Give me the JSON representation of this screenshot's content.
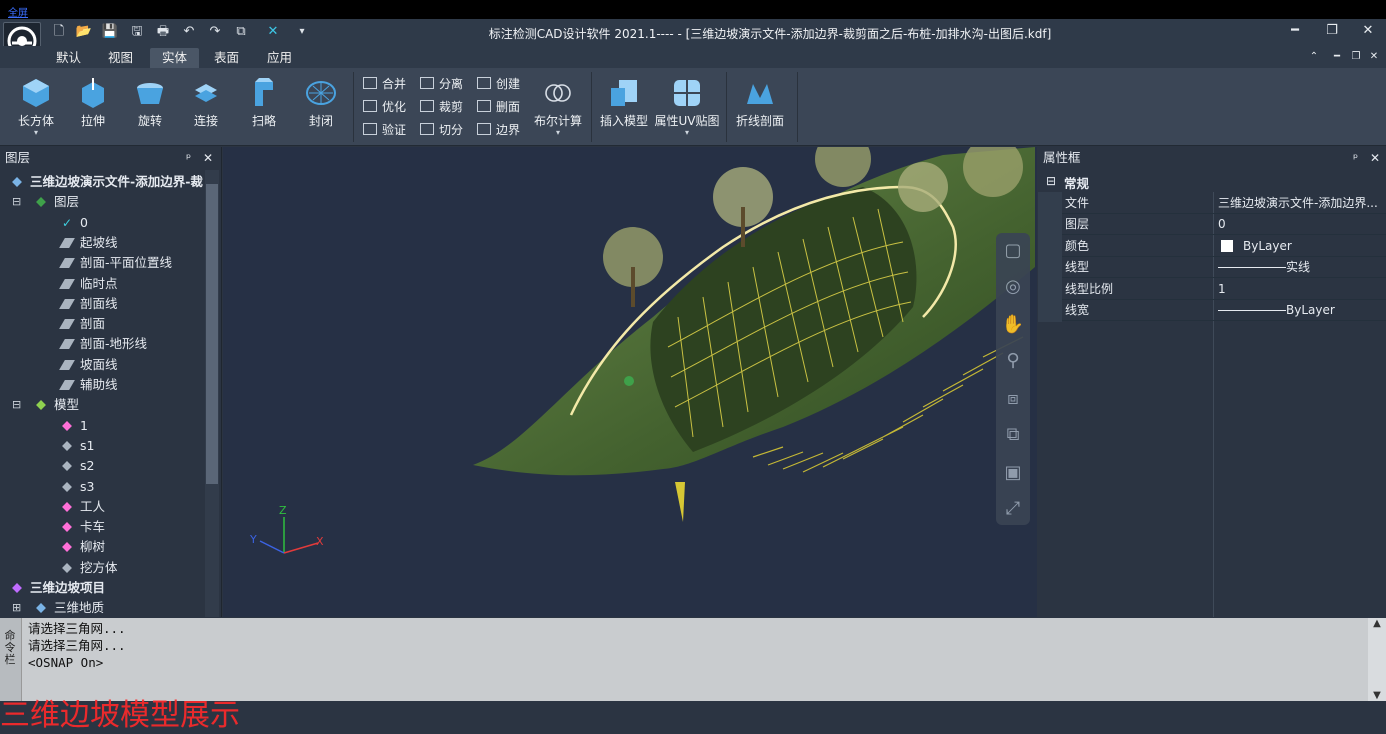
{
  "top_strip": {
    "label": "全屏"
  },
  "app": {
    "title": "标注检测CAD设计软件 2021.1---- - [三维边坡演示文件-添加边界-裁剪面之后-布桩-加排水沟-出图后.kdf]"
  },
  "menu_tabs": [
    {
      "label": "默认",
      "active": false
    },
    {
      "label": "视图",
      "active": false
    },
    {
      "label": "实体",
      "active": true
    },
    {
      "label": "表面",
      "active": false
    },
    {
      "label": "应用",
      "active": false
    }
  ],
  "ribbon": {
    "large": [
      {
        "label": "长方体",
        "icon": "box-icon",
        "dropdown": true
      },
      {
        "label": "拉伸",
        "icon": "extrude-icon",
        "dropdown": false
      },
      {
        "label": "旋转",
        "icon": "revolve-icon",
        "dropdown": false
      },
      {
        "label": "连接",
        "icon": "connect-icon",
        "dropdown": false
      },
      {
        "label": "扫略",
        "icon": "sweep-icon",
        "dropdown": false
      },
      {
        "label": "封闭",
        "icon": "close-mesh-icon",
        "dropdown": false
      }
    ],
    "small": [
      {
        "label": "合并",
        "icon": "merge-icon"
      },
      {
        "label": "优化",
        "icon": "optimize-icon"
      },
      {
        "label": "验证",
        "icon": "verify-icon"
      },
      {
        "label": "分离",
        "icon": "separate-icon"
      },
      {
        "label": "裁剪",
        "icon": "trim-icon"
      },
      {
        "label": "切分",
        "icon": "split-icon"
      },
      {
        "label": "创建",
        "icon": "create-icon"
      },
      {
        "label": "删面",
        "icon": "delete-face-icon"
      },
      {
        "label": "边界",
        "icon": "boundary-icon"
      }
    ],
    "boolean": {
      "label": "布尔计算",
      "icon": "boolean-icon"
    },
    "extra": [
      {
        "label": "插入模型",
        "icon": "insert-model-icon"
      },
      {
        "label": "属性UV贴图",
        "icon": "uv-map-icon"
      },
      {
        "label": "折线剖面",
        "icon": "polyline-section-icon"
      }
    ]
  },
  "layers_panel": {
    "title": "图层",
    "pin": "ᵖ",
    "close": "✕",
    "items": [
      {
        "label": "三维边坡演示文件-添加边界-裁",
        "level": 0,
        "expander": "",
        "kind": "file"
      },
      {
        "label": "图层",
        "level": 1,
        "expander": "⊟",
        "kind": "layers"
      },
      {
        "label": "0",
        "level": 2,
        "expander": "",
        "kind": "check"
      },
      {
        "label": "起坡线",
        "level": 2,
        "expander": "",
        "kind": "layer"
      },
      {
        "label": "剖面-平面位置线",
        "level": 2,
        "expander": "",
        "kind": "layer"
      },
      {
        "label": "临时点",
        "level": 2,
        "expander": "",
        "kind": "layer"
      },
      {
        "label": "剖面线",
        "level": 2,
        "expander": "",
        "kind": "layer"
      },
      {
        "label": "剖面",
        "level": 2,
        "expander": "",
        "kind": "layer"
      },
      {
        "label": "剖面-地形线",
        "level": 2,
        "expander": "",
        "kind": "layer"
      },
      {
        "label": "坡面线",
        "level": 2,
        "expander": "",
        "kind": "layer"
      },
      {
        "label": "辅助线",
        "level": 2,
        "expander": "",
        "kind": "layer"
      },
      {
        "label": "模型",
        "level": 1,
        "expander": "⊟",
        "kind": "model"
      },
      {
        "label": "1",
        "level": 2,
        "expander": "",
        "kind": "pink"
      },
      {
        "label": "s1",
        "level": 2,
        "expander": "",
        "kind": "grey"
      },
      {
        "label": "s2",
        "level": 2,
        "expander": "",
        "kind": "grey"
      },
      {
        "label": "s3",
        "level": 2,
        "expander": "",
        "kind": "grey"
      },
      {
        "label": "工人",
        "level": 2,
        "expander": "",
        "kind": "pink"
      },
      {
        "label": "卡车",
        "level": 2,
        "expander": "",
        "kind": "pink"
      },
      {
        "label": "柳树",
        "level": 2,
        "expander": "",
        "kind": "pink"
      },
      {
        "label": "挖方体",
        "level": 2,
        "expander": "",
        "kind": "grey"
      },
      {
        "label": "三维边坡项目",
        "level": 0,
        "expander": "",
        "kind": "project"
      },
      {
        "label": "三维地质",
        "level": 1,
        "expander": "⊞",
        "kind": "geology"
      }
    ]
  },
  "properties_panel": {
    "title": "属性框",
    "section": "常规",
    "rows": [
      {
        "key": "文件",
        "value": "三维边坡演示文件-添加边界..."
      },
      {
        "key": "图层",
        "value": "0"
      },
      {
        "key": "颜色",
        "value": "ByLayer"
      },
      {
        "key": "线型",
        "value": "实线"
      },
      {
        "key": "线型比例",
        "value": "1"
      },
      {
        "key": "线宽",
        "value": "ByLayer"
      }
    ]
  },
  "axes": {
    "z": "Z",
    "y": "Y",
    "x": "X"
  },
  "command_line": {
    "side_label": "命令栏",
    "lines": [
      "请选择三角网...",
      "请选择三角网...",
      "<OSNAP On>"
    ]
  },
  "watermark": {
    "text": "三维边坡模型展示"
  },
  "colors": {
    "accent_tab": "#4a5666",
    "panel_bg": "#2b3442",
    "viewport_bg": "#263045",
    "slope_green": "#4d6a3a",
    "structure_yellow": "#e5d84a"
  }
}
